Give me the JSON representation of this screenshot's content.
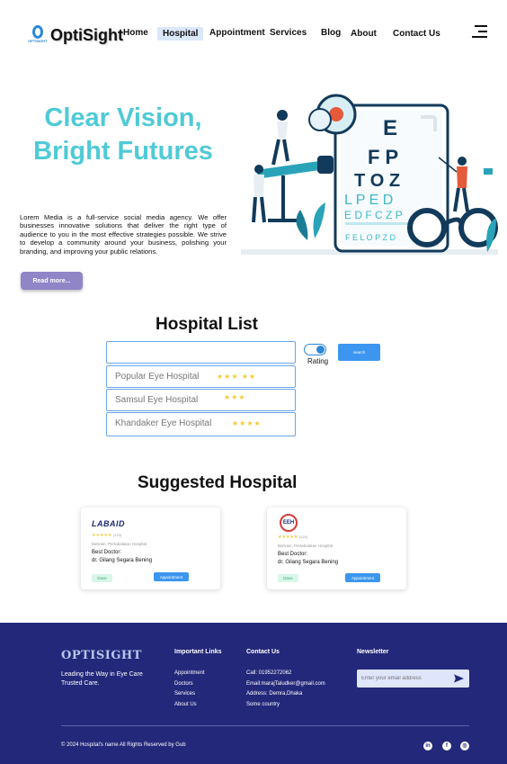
{
  "header": {
    "logo_text": "OptiSight",
    "logo_sub": "OPTISIGHT",
    "nav": [
      {
        "label": "Home"
      },
      {
        "label": "Hospital"
      },
      {
        "label": "Appointment"
      },
      {
        "label": "Services"
      },
      {
        "label": "Blog"
      },
      {
        "label": "About"
      },
      {
        "label": "Contact Us"
      }
    ],
    "active_nav": "Hospital"
  },
  "hero": {
    "title_line1": "Clear Vision,",
    "title_line2": "Bright Futures",
    "body": "Lorem Media is a full-service social media agency. We offer businesses innovative solutions that deliver the right type of audience to you in the most effective strategies possible. We strive to develop a community around your business, polishing your branding, and improving your public relations.",
    "button_label": "Read more...",
    "chart_letters": [
      "E",
      "F P",
      "T O Z",
      "L P E D",
      "E D F C Z P",
      "F E L O P Z D"
    ]
  },
  "hospital_list": {
    "title": "Hospital List",
    "search_value": "",
    "rating_label": "Rating",
    "rating_toggle": "on",
    "search_button": "search",
    "items": [
      {
        "name": "Popular Eye Hospital",
        "stars": "★★★ ★★"
      },
      {
        "name": "Samsul Eye Hospital",
        "stars": "★★★"
      },
      {
        "name": "Khandaker Eye Hospital",
        "stars": "★★★★"
      }
    ]
  },
  "suggested": {
    "title": "Suggested Hospital",
    "cards": [
      {
        "brand": "LABAID",
        "stars": "★★★★★",
        "review_count": "(120)",
        "location": "Bahrain, Pertabalatan Hospital",
        "best_label": "Best Doctor:",
        "doctor": "dr. Gilang Segara Bening",
        "btn_primary": "Dave",
        "btn_secondary": "Appointment"
      },
      {
        "brand": "EEH",
        "stars": "★★★★★",
        "review_count": "(120)",
        "location": "Bahrain, Pertabalatan Hospital",
        "best_label": "Best Doctor:",
        "doctor": "dr. Gilang Segara Bening",
        "btn_primary": "Dave",
        "btn_secondary": "Appointment"
      }
    ]
  },
  "footer": {
    "brand": "OPTISIGHT",
    "tagline": "Leading the Way in Eye Care Trusted Care.",
    "links_title": "Important Links",
    "links": [
      "Appointment",
      "Doctors",
      "Services",
      "About Us"
    ],
    "contact_title": "Contact Us",
    "contact": [
      "Call: 01952272062",
      "Email:marajTaludker@gmail.com",
      "Address: Demra,Dhaka",
      "Some country"
    ],
    "newsletter_title": "Newsletter",
    "newsletter_placeholder": "Enter your email address",
    "copyright": "© 2024 Hospital's name All Rights Reserved by Gub",
    "social_icons": [
      "linkedin-icon",
      "facebook-icon",
      "instagram-icon"
    ]
  },
  "colors": {
    "accent": "#4fcad6",
    "primary_blue": "#3c96f0",
    "footer_bg": "#23287a",
    "button_purple": "#8f85c7",
    "star": "#f5cb32"
  }
}
